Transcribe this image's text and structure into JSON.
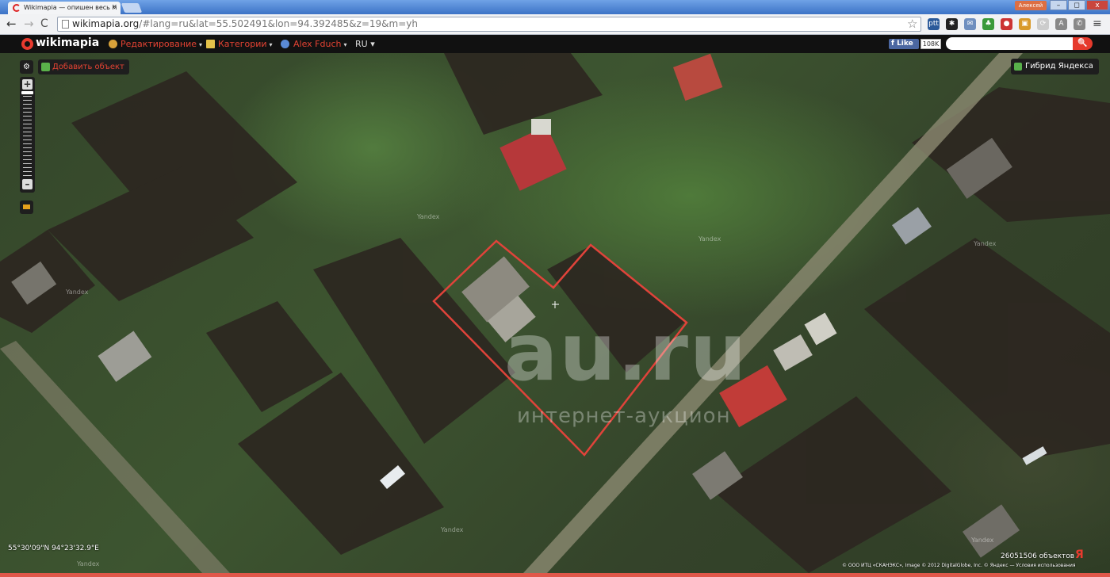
{
  "browser": {
    "tab_title": "Wikimapia — опишен весь м",
    "tab_close": "×",
    "profile_name": "Алексей",
    "window_min": "–",
    "window_max": "◻",
    "window_close": "x",
    "back": "←",
    "forward": "→",
    "reload": "C",
    "url_host": "wikimapia.org",
    "url_path": "/#lang=ru&lat=55.502491&lon=94.392485&z=19&m=yh",
    "bookmark_star": "☆",
    "menu": "≡",
    "extensions": [
      {
        "name": "pttl-extension-icon",
        "label": "ptt",
        "color": "#2b5a9a"
      },
      {
        "name": "gear-extension-icon",
        "label": "✱",
        "color": "#222222"
      },
      {
        "name": "mail-extension-icon",
        "label": "✉",
        "color": "#6f8fbf"
      },
      {
        "name": "evernote-extension-icon",
        "label": "♣",
        "color": "#3a9a3a"
      },
      {
        "name": "adblock-extension-icon",
        "label": "●",
        "color": "#cc3333"
      },
      {
        "name": "photo-extension-icon",
        "label": "▣",
        "color": "#d99a2a"
      },
      {
        "name": "refresh-extension-icon",
        "label": "⟳",
        "color": "#cccccc"
      },
      {
        "name": "translate-extension-icon",
        "label": "A",
        "color": "#888888"
      },
      {
        "name": "phone-extension-icon",
        "label": "✆",
        "color": "#888888"
      }
    ]
  },
  "wikimapia": {
    "logo": "wikimapia",
    "menu": [
      {
        "label": "Редактирование",
        "icon_color": "#d9a23a"
      },
      {
        "label": "Категории",
        "icon_color": "#e5c24a"
      },
      {
        "label": "Alex Fduch",
        "icon_color": "#5a8ad6"
      }
    ],
    "language": "RU ▾",
    "caret": "▾",
    "fb_like": "Like",
    "fb_count": "108K",
    "search_placeholder": "",
    "search_icon": "🔍"
  },
  "map": {
    "settings_icon": "⚙",
    "add_object": "Добавить объект",
    "zoom_in": "+",
    "zoom_out": "–",
    "hybrid_label": "Гибрид Яндекса",
    "watermark_main": "au.ru",
    "watermark_sub": "интернет-аукцион",
    "yandex_watermark": "Yandex",
    "coordinates": "55°30'09\"N 94°23'32.9\"E",
    "objects_count": "26051506 объектов",
    "copyright": "© ООО ИТЦ «СКАНЭКС», Image © 2012 DigitalGlobe, Inc. © Яндекс — Условия использования",
    "yandex_logo": "Я",
    "parcel_outline_color": "#e0433a"
  }
}
